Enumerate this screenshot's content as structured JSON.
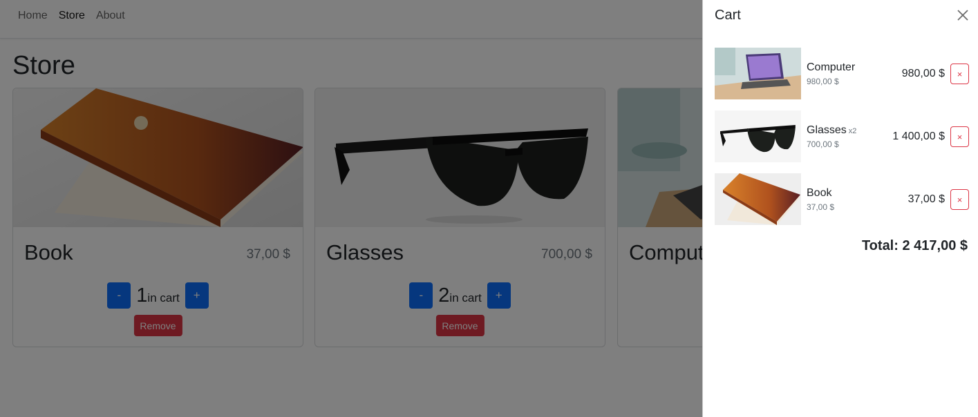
{
  "nav": {
    "items": [
      {
        "label": "Home"
      },
      {
        "label": "Store"
      },
      {
        "label": "About"
      }
    ]
  },
  "page": {
    "title": "Store"
  },
  "products": [
    {
      "name": "Book",
      "price": "37,00 $",
      "quantity": "1",
      "in_cart_label": "in cart",
      "minus_label": "-",
      "plus_label": "+",
      "remove_label": "Remove"
    },
    {
      "name": "Glasses",
      "price": "700,00 $",
      "quantity": "2",
      "in_cart_label": "in cart",
      "minus_label": "-",
      "plus_label": "+",
      "remove_label": "Remove"
    },
    {
      "name": "Comput"
    }
  ],
  "cart": {
    "title": "Cart",
    "items": [
      {
        "name": "Computer",
        "qty": "",
        "unit_price": "980,00 $",
        "total": "980,00 $",
        "remove_label": "×"
      },
      {
        "name": "Glasses",
        "qty": "x2",
        "unit_price": "700,00 $",
        "total": "1 400,00 $",
        "remove_label": "×"
      },
      {
        "name": "Book",
        "qty": "",
        "unit_price": "37,00 $",
        "total": "37,00 $",
        "remove_label": "×"
      }
    ],
    "total_label": "Total: 2 417,00 $"
  },
  "colors": {
    "primary": "#0d6efd",
    "danger": "#dc3545",
    "overlay": "rgba(0,0,0,0.5)"
  }
}
